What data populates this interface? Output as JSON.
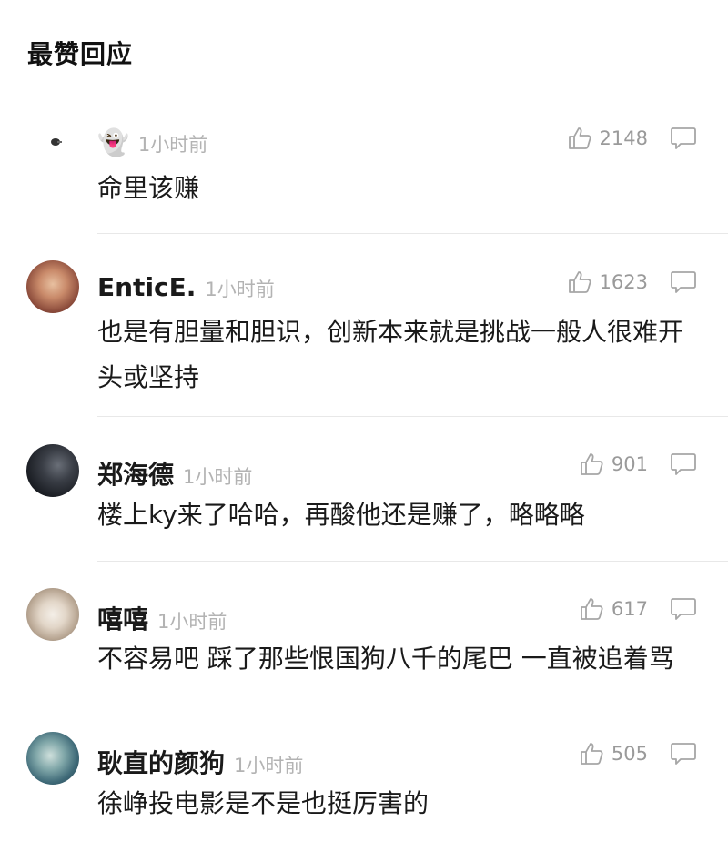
{
  "section_title": "最赞回应",
  "comments": [
    {
      "username": "👻",
      "time": "1小时前",
      "text": "命里该赚",
      "likes": "2148"
    },
    {
      "username": "EnticE.",
      "time": "1小时前",
      "text": "也是有胆量和胆识，创新本来就是挑战一般人很难开头或坚持",
      "likes": "1623"
    },
    {
      "username": "郑海德",
      "time": "1小时前",
      "text": "楼上ky来了哈哈，再酸他还是赚了，略略略",
      "likes": "901"
    },
    {
      "username": "嘻嘻",
      "time": "1小时前",
      "text": "不容易吧 踩了那些恨国狗八千的尾巴 一直被追着骂",
      "likes": "617"
    },
    {
      "username": "耿直的颜狗",
      "time": "1小时前",
      "text": "徐峥投电影是不是也挺厉害的",
      "likes": "505"
    }
  ],
  "icons": {
    "like": "thumbs-up-outline",
    "reply": "speech-bubble-outline"
  },
  "colors": {
    "text": "#1a1a1a",
    "muted": "#b3b3b3",
    "count": "#9a9a9a",
    "divider": "#e8e8e8"
  }
}
